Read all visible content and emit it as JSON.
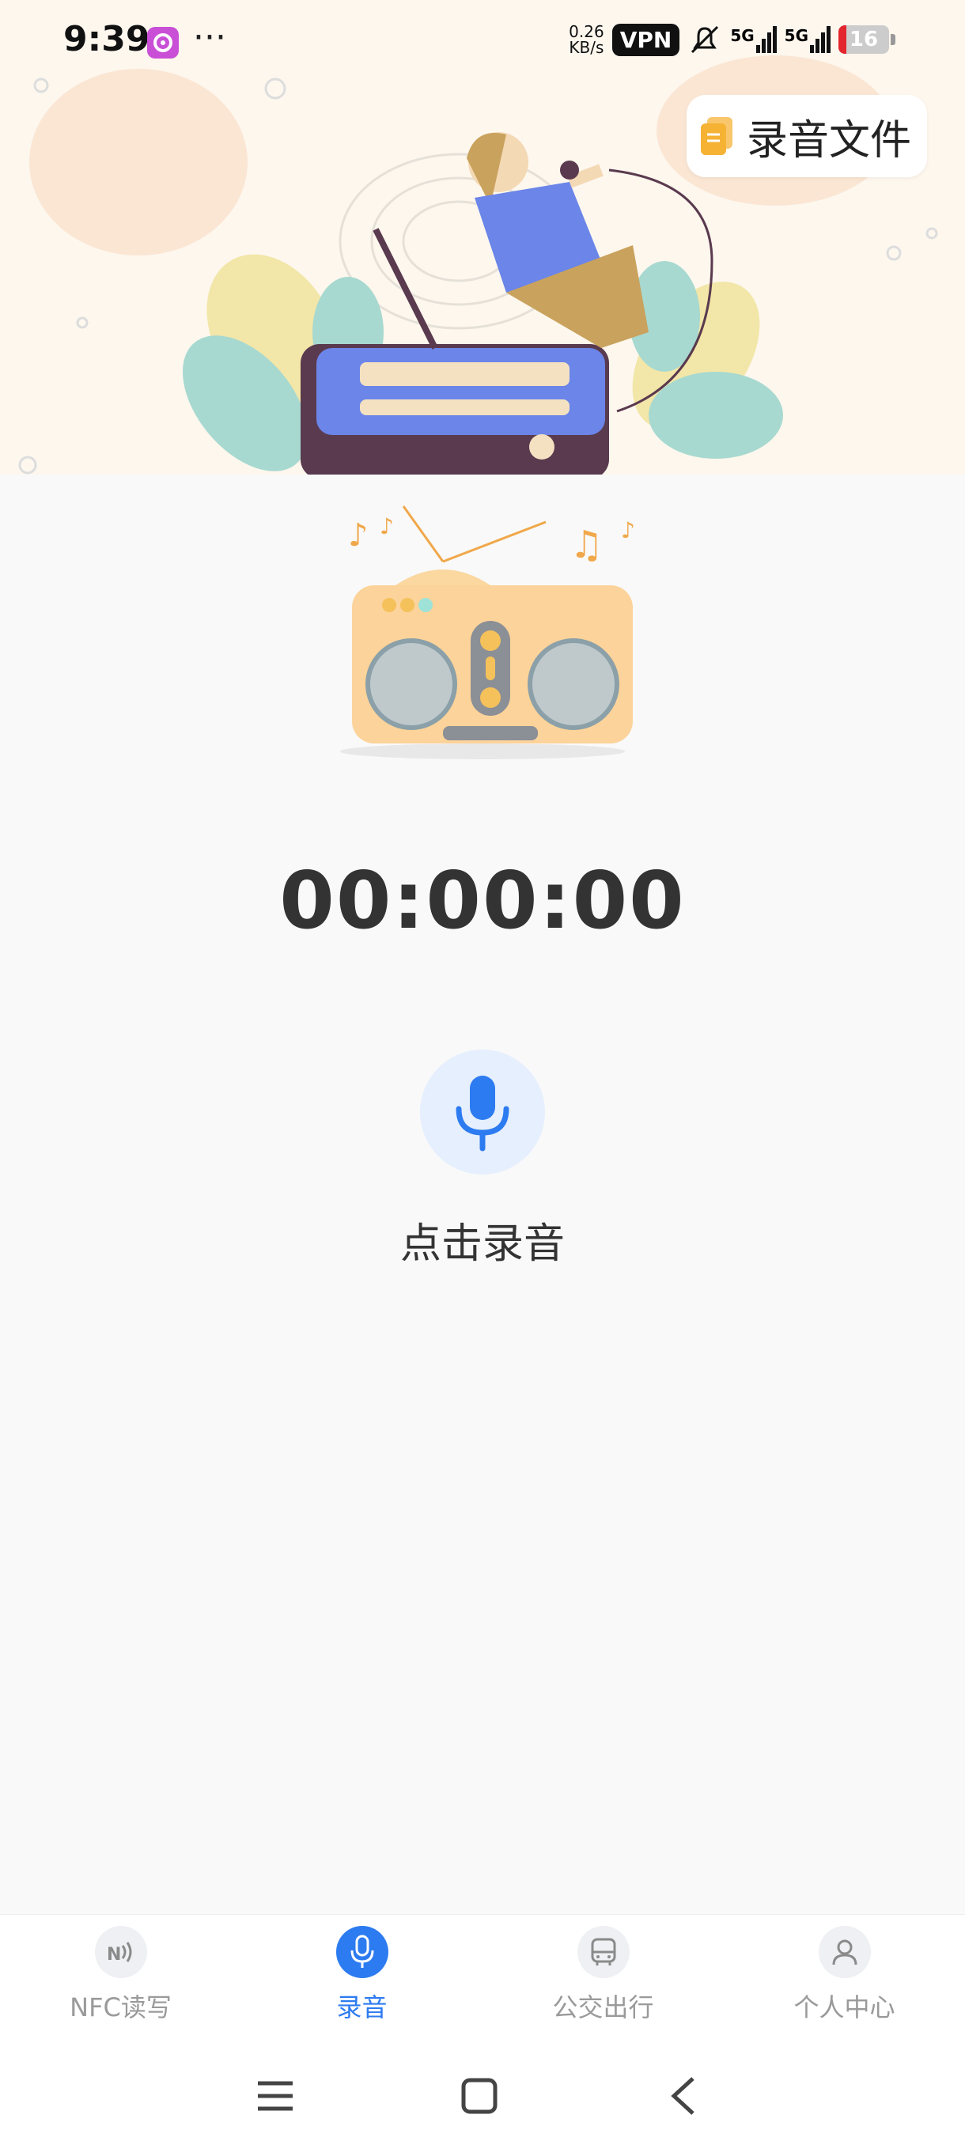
{
  "status": {
    "time": "9:39",
    "more": "···",
    "speed_value": "0.26",
    "speed_unit": "KB/s",
    "vpn": "VPN",
    "net1": "5G",
    "net2": "5G",
    "battery": "16",
    "battery_level": 0.16
  },
  "header": {
    "record_files_label": "录音文件"
  },
  "recorder": {
    "timer": "00:00:00",
    "tap_label": "点击录音"
  },
  "nav": {
    "items": [
      {
        "label": "NFC读写",
        "icon": "nfc-icon",
        "active": false
      },
      {
        "label": "录音",
        "icon": "mic-icon",
        "active": true
      },
      {
        "label": "公交出行",
        "icon": "bus-icon",
        "active": false
      },
      {
        "label": "个人中心",
        "icon": "person-icon",
        "active": false
      }
    ]
  },
  "colors": {
    "accent": "#2d7bf0",
    "mic_bg": "#e6effd",
    "banner_bg": "#fdf7ee"
  }
}
